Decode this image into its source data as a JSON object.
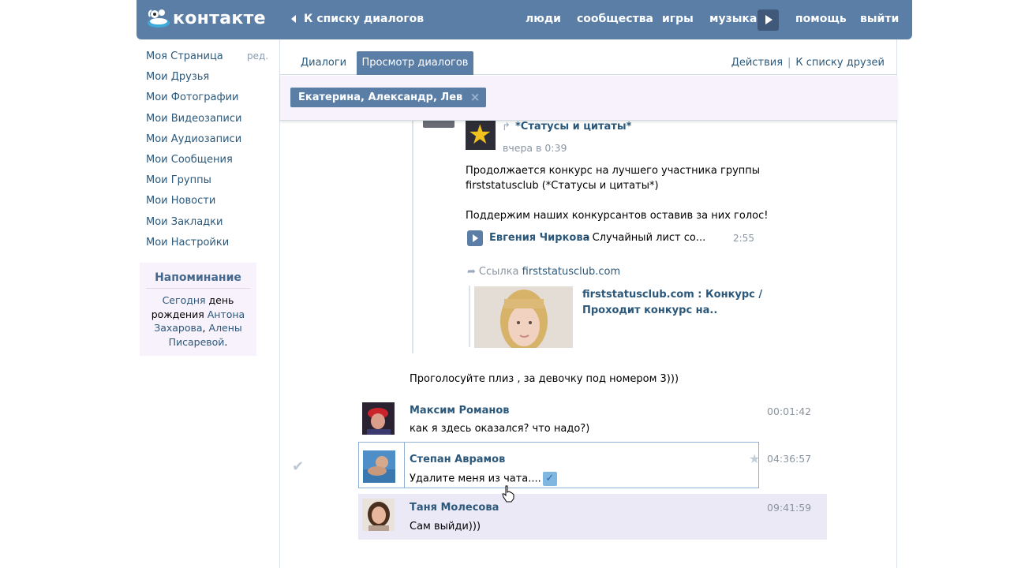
{
  "header": {
    "logo_text": "контакте",
    "back_label": "К списку диалогов",
    "nav": [
      "люди",
      "сообщества",
      "игры",
      "музыка",
      "помощь",
      "выйти"
    ],
    "accent": "#5b7ea7"
  },
  "sidebar": {
    "edit_label": "ред.",
    "items": [
      {
        "label": "Моя Страница"
      },
      {
        "label": "Мои Друзья"
      },
      {
        "label": "Мои Фотографии"
      },
      {
        "label": "Мои Видеозаписи"
      },
      {
        "label": "Мои Аудиозаписи"
      },
      {
        "label": "Мои Сообщения"
      },
      {
        "label": "Мои Группы"
      },
      {
        "label": "Мои Новости"
      },
      {
        "label": "Мои Закладки"
      },
      {
        "label": "Мои Настройки"
      }
    ],
    "reminder": {
      "title": "Напоминание",
      "today": "Сегодня",
      "birthday": "день рождения",
      "name1": "Антона Захарова",
      "comma": ",",
      "name2": "Алены Писаревой",
      "dot": "."
    }
  },
  "tabs": {
    "dialogs": "Диалоги",
    "view": "Просмотр диалогов",
    "actions": "Действия",
    "separator": "|",
    "friends": "К списку друзей"
  },
  "participants": {
    "label": "Екатерина, Александр, Лев",
    "close_icon": "×"
  },
  "post": {
    "group_name": "*Статусы и цитаты*",
    "time": "вчера в 0:39",
    "text_line1": "Продолжается конкурс на лучшего участника группы",
    "text_line2": "firststatusclub (*Статусы и цитаты*)",
    "text_line3": "Поддержим наших конкурсантов оставив за них голос!",
    "audio": {
      "artist": "Евгения Чиркова",
      "title": "– Случайный лист со...",
      "duration": "2:55"
    },
    "link": {
      "prefix": "Ссылка",
      "domain": "firststatusclub.com",
      "title_line1": "firststatusclub.com : Конкурс /",
      "title_line2": "Проходит конкурс на.."
    }
  },
  "vote_message": "Проголосуйте плиз , за девочку под номером 3)))",
  "messages": [
    {
      "author": "Максим Романов",
      "text": "как я здесь оказался? что надо?)",
      "time": "00:01:42"
    },
    {
      "author": "Степан Аврамов",
      "text": "Удалите меня из чата....",
      "time": "04:36:57",
      "selected": true
    },
    {
      "author": "Таня Молесова",
      "text": "Сам выйди)))",
      "time": "09:41:59",
      "unread": true
    }
  ]
}
